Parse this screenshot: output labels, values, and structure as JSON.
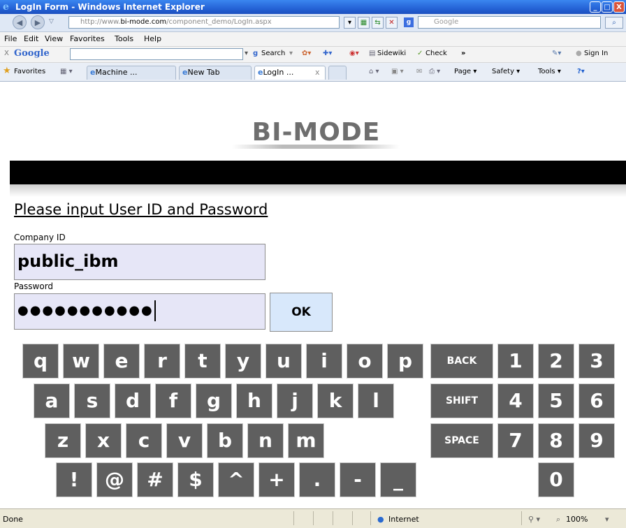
{
  "window": {
    "title": "LogIn Form - Windows Internet Explorer",
    "buttons": {
      "minimize": "_",
      "maximize": "□",
      "close": "X"
    }
  },
  "address_bar": {
    "url_prefix": "http://www.",
    "url_domain": "bi-mode.com",
    "url_path": "/component_demo/LogIn.aspx",
    "search_placeholder": "Google"
  },
  "menu": [
    "File",
    "Edit",
    "View",
    "Favorites",
    "Tools",
    "Help"
  ],
  "google_toolbar": {
    "close": "X",
    "brand": "Google",
    "search": "Search",
    "sidewiki": "Sidewiki",
    "check": "Check",
    "more": "»",
    "sign_in": "Sign In"
  },
  "tabs_row": {
    "favorites": "Favorites",
    "tabs": [
      {
        "label": "Machine ..."
      },
      {
        "label": "New Tab"
      },
      {
        "label": "LogIn ...",
        "close": "x"
      }
    ],
    "commands": {
      "page": "Page",
      "safety": "Safety",
      "tools": "Tools"
    }
  },
  "page": {
    "logo": "BI-MODE",
    "instruction": "Please input User ID and Password",
    "company_label": "Company ID",
    "company_value": "public_ibm",
    "password_label": "Password",
    "password_value": "●●●●●●●●●●●",
    "ok_label": "OK"
  },
  "keyboard": {
    "row1": [
      "q",
      "w",
      "e",
      "r",
      "t",
      "y",
      "u",
      "i",
      "o",
      "p"
    ],
    "row2": [
      "a",
      "s",
      "d",
      "f",
      "g",
      "h",
      "j",
      "k",
      "l"
    ],
    "row3": [
      "z",
      "x",
      "c",
      "v",
      "b",
      "n",
      "m"
    ],
    "row4": [
      "!",
      "@",
      "#",
      "$",
      "^",
      "+",
      ".",
      "-",
      "_"
    ],
    "specials": [
      "BACK",
      "SHIFT",
      "SPACE"
    ],
    "numpad": [
      [
        "1",
        "2",
        "3"
      ],
      [
        "4",
        "5",
        "6"
      ],
      [
        "7",
        "8",
        "9"
      ],
      [
        "0"
      ]
    ]
  },
  "status_bar": {
    "left": "Done",
    "zone": "Internet",
    "zoom": "100%"
  },
  "colors": {
    "titlebar": "#2563d6",
    "key_bg": "#5f5f5f",
    "field_bg": "#e6e6f7",
    "ok_bg": "#d8e8fb"
  }
}
